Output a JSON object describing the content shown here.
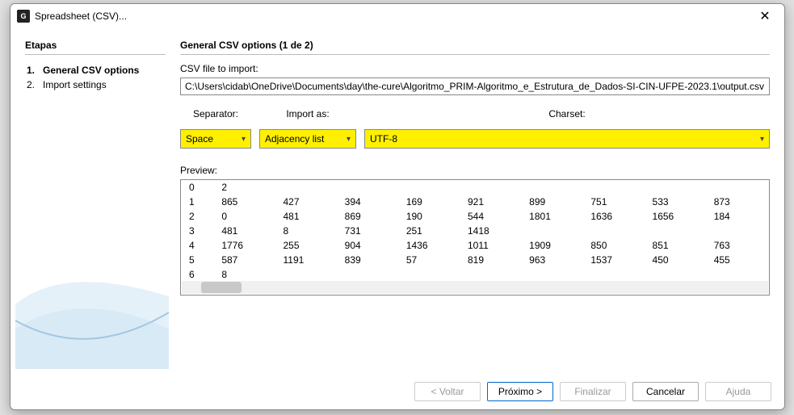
{
  "window": {
    "title": "Spreadsheet (CSV)..."
  },
  "sidebar": {
    "heading": "Etapas",
    "steps": [
      {
        "num": "1.",
        "label": "General CSV options"
      },
      {
        "num": "2.",
        "label": "Import settings"
      }
    ]
  },
  "main": {
    "heading": "General CSV options (1 de 2)",
    "file_label": "CSV file to import:",
    "file_path": "C:\\Users\\cidab\\OneDrive\\Documents\\day\\the-cure\\Algoritmo_PRIM-Algoritmo_e_Estrutura_de_Dados-SI-CIN-UFPE-2023.1\\output.csv",
    "separator_label": "Separator:",
    "separator_value": "Space",
    "importas_label": "Import as:",
    "importas_value": "Adjacency list",
    "charset_label": "Charset:",
    "charset_value": "UTF-8",
    "preview_label": "Preview:",
    "preview_rows": [
      [
        "0",
        "2",
        "",
        "",
        "",
        "",
        "",
        "",
        "",
        ""
      ],
      [
        "1",
        "865",
        "427",
        "394",
        "169",
        "921",
        "899",
        "751",
        "533",
        "873"
      ],
      [
        "2",
        "0",
        "481",
        "869",
        "190",
        "544",
        "1801",
        "1636",
        "1656",
        "184"
      ],
      [
        "3",
        "481",
        "8",
        "731",
        "251",
        "1418",
        "",
        "",
        "",
        ""
      ],
      [
        "4",
        "1776",
        "255",
        "904",
        "1436",
        "1011",
        "1909",
        "850",
        "851",
        "763"
      ],
      [
        "5",
        "587",
        "1191",
        "839",
        "57",
        "819",
        "963",
        "1537",
        "450",
        "455"
      ],
      [
        "6",
        "8",
        "",
        "",
        "",
        "",
        "",
        "",
        "",
        ""
      ]
    ]
  },
  "footer": {
    "back": "< Voltar",
    "next": "Próximo >",
    "finish": "Finalizar",
    "cancel": "Cancelar",
    "help": "Ajuda"
  }
}
